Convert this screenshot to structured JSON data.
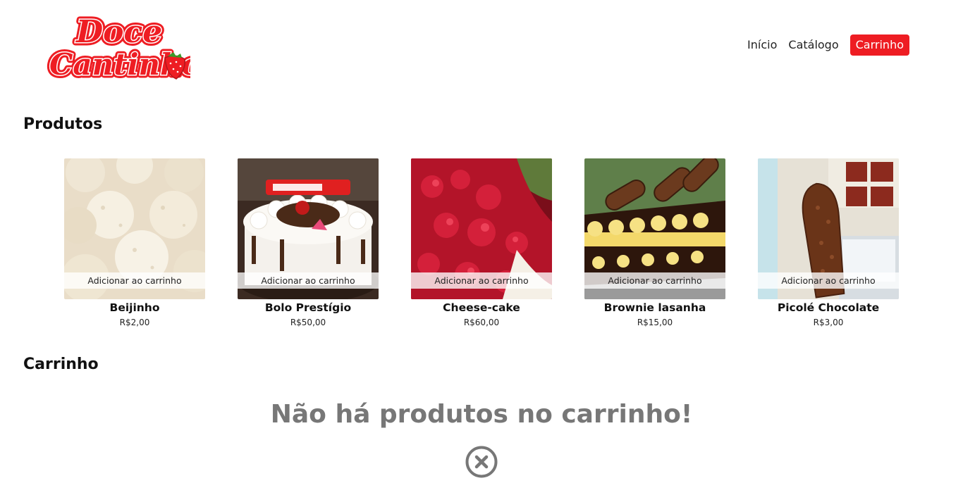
{
  "brand": {
    "name_line1": "Doce",
    "name_line2": "Cantinho",
    "color": "#ee1d23"
  },
  "nav": {
    "items": [
      {
        "label": "Início"
      },
      {
        "label": "Catálogo"
      },
      {
        "label": "Carrinho",
        "active": true
      }
    ]
  },
  "products_section": {
    "title": "Produtos",
    "add_label": "Adicionar ao carrinho"
  },
  "products": [
    {
      "name": "Beijinho",
      "price": "R$2,00",
      "image_icon": "coconut-candy"
    },
    {
      "name": "Bolo Prestígio",
      "price": "R$50,00",
      "image_icon": "chocolate-cake"
    },
    {
      "name": "Cheese-cake",
      "price": "R$60,00",
      "image_icon": "berry-cheesecake"
    },
    {
      "name": "Brownie lasanha",
      "price": "R$15,00",
      "image_icon": "brownie"
    },
    {
      "name": "Picolé Chocolate",
      "price": "R$3,00",
      "image_icon": "popsicle"
    }
  ],
  "cart_section": {
    "title": "Carrinho",
    "empty_message": "Não há produtos no carrinho!",
    "empty_icon": "close-circle-icon"
  }
}
